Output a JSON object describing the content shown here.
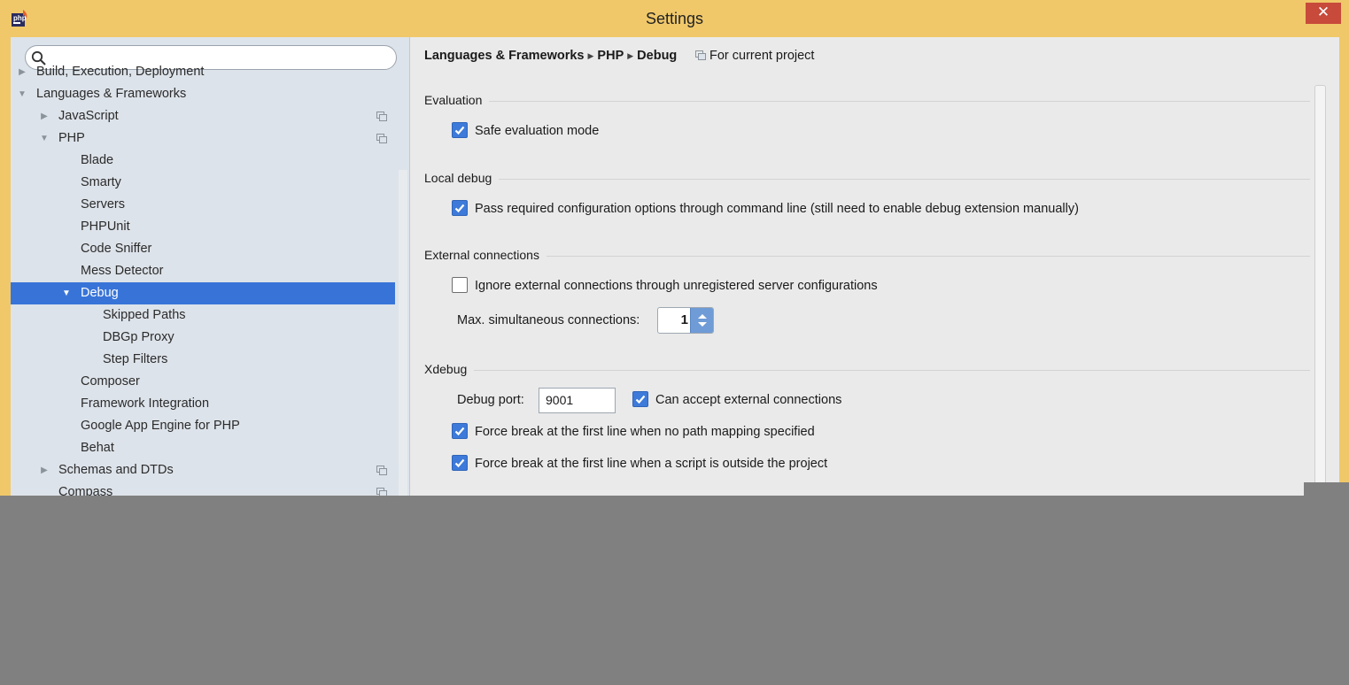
{
  "window": {
    "title": "Settings",
    "close_glyph": "✕",
    "app_icon": "phpstorm-icon"
  },
  "search": {
    "placeholder": "",
    "value": ""
  },
  "sidebar": {
    "items": [
      {
        "label": "Build, Execution, Deployment",
        "level": 0,
        "arrow": "right",
        "project_icon": false
      },
      {
        "label": "Languages & Frameworks",
        "level": 0,
        "arrow": "down",
        "project_icon": false
      },
      {
        "label": "JavaScript",
        "level": 1,
        "arrow": "right",
        "project_icon": true
      },
      {
        "label": "PHP",
        "level": 1,
        "arrow": "down",
        "project_icon": true
      },
      {
        "label": "Blade",
        "level": 2,
        "arrow": "",
        "project_icon": false
      },
      {
        "label": "Smarty",
        "level": 2,
        "arrow": "",
        "project_icon": false
      },
      {
        "label": "Servers",
        "level": 2,
        "arrow": "",
        "project_icon": false
      },
      {
        "label": "PHPUnit",
        "level": 2,
        "arrow": "",
        "project_icon": false
      },
      {
        "label": "Code Sniffer",
        "level": 2,
        "arrow": "",
        "project_icon": false
      },
      {
        "label": "Mess Detector",
        "level": 2,
        "arrow": "",
        "project_icon": false
      },
      {
        "label": "Debug",
        "level": 2,
        "arrow": "down",
        "project_icon": false,
        "selected": true
      },
      {
        "label": "Skipped Paths",
        "level": 3,
        "arrow": "",
        "project_icon": false
      },
      {
        "label": "DBGp Proxy",
        "level": 3,
        "arrow": "",
        "project_icon": false
      },
      {
        "label": "Step Filters",
        "level": 3,
        "arrow": "",
        "project_icon": false
      },
      {
        "label": "Composer",
        "level": 2,
        "arrow": "",
        "project_icon": false
      },
      {
        "label": "Framework Integration",
        "level": 2,
        "arrow": "",
        "project_icon": false
      },
      {
        "label": "Google App Engine for PHP",
        "level": 2,
        "arrow": "",
        "project_icon": false
      },
      {
        "label": "Behat",
        "level": 2,
        "arrow": "",
        "project_icon": false
      },
      {
        "label": "Schemas and DTDs",
        "level": 1,
        "arrow": "right",
        "project_icon": true
      },
      {
        "label": "Compass",
        "level": 1,
        "arrow": "",
        "project_icon": true
      }
    ]
  },
  "breadcrumb": {
    "parts": [
      "Languages & Frameworks",
      "PHP",
      "Debug"
    ],
    "scope_label": "For current project"
  },
  "sections": {
    "evaluation": {
      "title": "Evaluation",
      "safe_eval": {
        "label": "Safe evaluation mode",
        "checked": true
      }
    },
    "local_debug": {
      "title": "Local debug",
      "pass_config": {
        "label": "Pass required configuration options through command line (still need to enable debug extension manually)",
        "checked": true
      }
    },
    "external": {
      "title": "External connections",
      "ignore_external": {
        "label": "Ignore external connections through unregistered server configurations",
        "checked": false
      },
      "max_label": "Max. simultaneous connections:",
      "max_value": "1"
    },
    "xdebug": {
      "title": "Xdebug",
      "port_label": "Debug port:",
      "port_value": "9001",
      "accept_external": {
        "label": "Can accept external connections",
        "checked": true
      },
      "force_no_mapping": {
        "label": "Force break at the first line when no path mapping specified",
        "checked": true
      },
      "force_outside": {
        "label": "Force break at the first line when a script is outside the project",
        "checked": true
      }
    }
  },
  "colors": {
    "titlebar": "#f0c86a",
    "selection": "#3874d8",
    "checkbox": "#3d7ad9",
    "close": "#c74a3a"
  }
}
